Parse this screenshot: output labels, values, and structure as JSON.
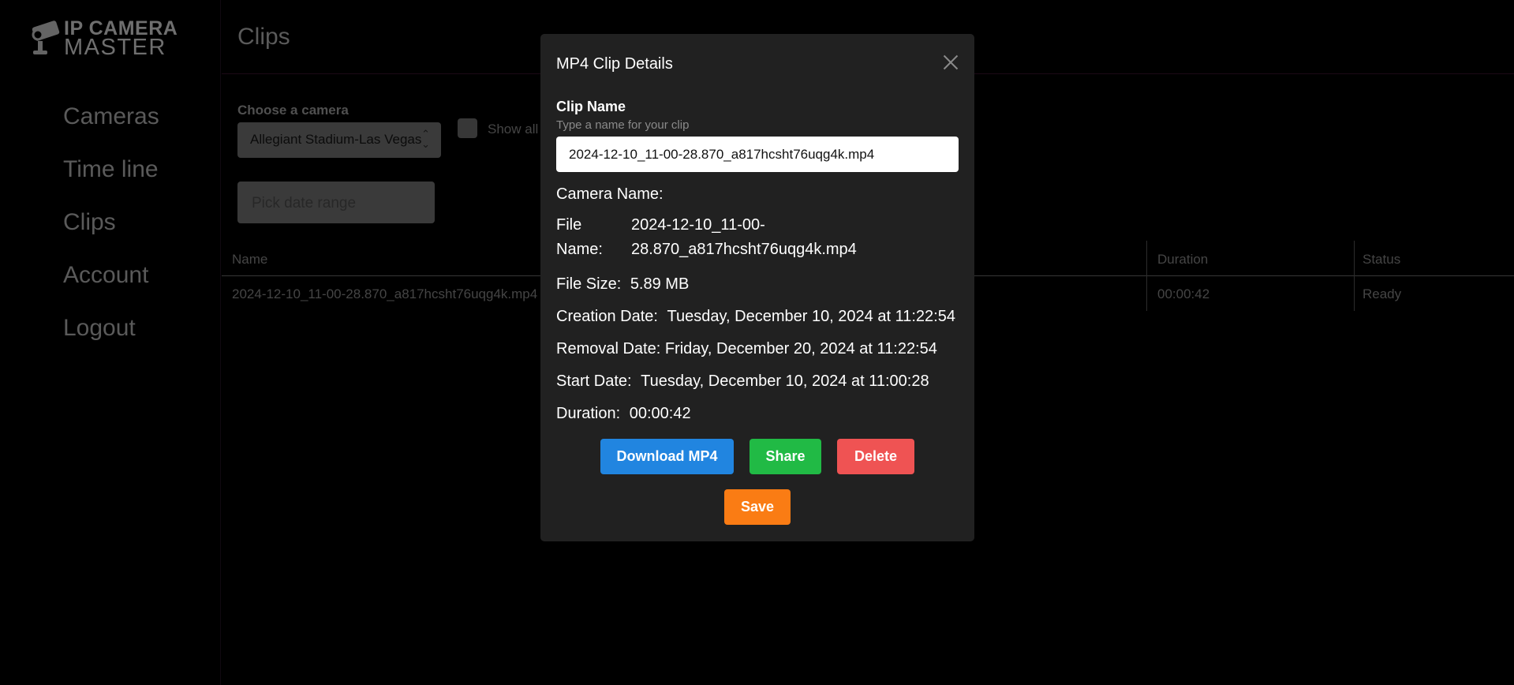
{
  "app": {
    "logo_line1": "IP CAMERA",
    "logo_line2": "MASTER"
  },
  "sidebar": {
    "items": [
      {
        "label": "Cameras"
      },
      {
        "label": "Time line"
      },
      {
        "label": "Clips"
      },
      {
        "label": "Account"
      },
      {
        "label": "Logout"
      }
    ]
  },
  "header": {
    "title": "Clips"
  },
  "filters": {
    "camera_label": "Choose a camera",
    "camera_selected": "Allegiant Stadium-Las Vegas",
    "show_all_label": "Show all",
    "show_all_checked": false,
    "date_range_placeholder": "Pick date range"
  },
  "table": {
    "columns": [
      "Name",
      "Duration",
      "Status"
    ],
    "rows": [
      {
        "name": "2024-12-10_11-00-28.870_a817hcsht76uqg4k.mp4",
        "duration": "00:00:42",
        "status": "Ready"
      }
    ]
  },
  "modal": {
    "title": "MP4 Clip Details",
    "clip_name_label": "Clip Name",
    "clip_name_help": "Type a name for your clip",
    "clip_name_value": "2024-12-10_11-00-28.870_a817hcsht76uqg4k.mp4",
    "camera_name_label": "Camera Name:",
    "file_name_label_1": "File",
    "file_name_label_2": "Name:",
    "file_name_value_1": "2024-12-10_11-00-",
    "file_name_value_2": "28.870_a817hcsht76uqg4k.mp4",
    "file_size_label": "File Size:",
    "file_size_value": "5.89 MB",
    "creation_label": "Creation Date:",
    "creation_value": "Tuesday, December 10, 2024 at 11:22:54",
    "removal_label": "Removal Date:",
    "removal_value": "Friday, December 20, 2024 at 11:22:54",
    "start_label": "Start Date:",
    "start_value": "Tuesday, December 10, 2024 at 11:00:28",
    "duration_label": "Duration:",
    "duration_value": "00:00:42",
    "buttons": {
      "download": "Download MP4",
      "share": "Share",
      "delete": "Delete",
      "save": "Save"
    }
  },
  "colors": {
    "download": "#2185e0",
    "share": "#21ba45",
    "delete": "#ef5353",
    "save": "#fa7c14",
    "modal_bg": "#212121"
  }
}
